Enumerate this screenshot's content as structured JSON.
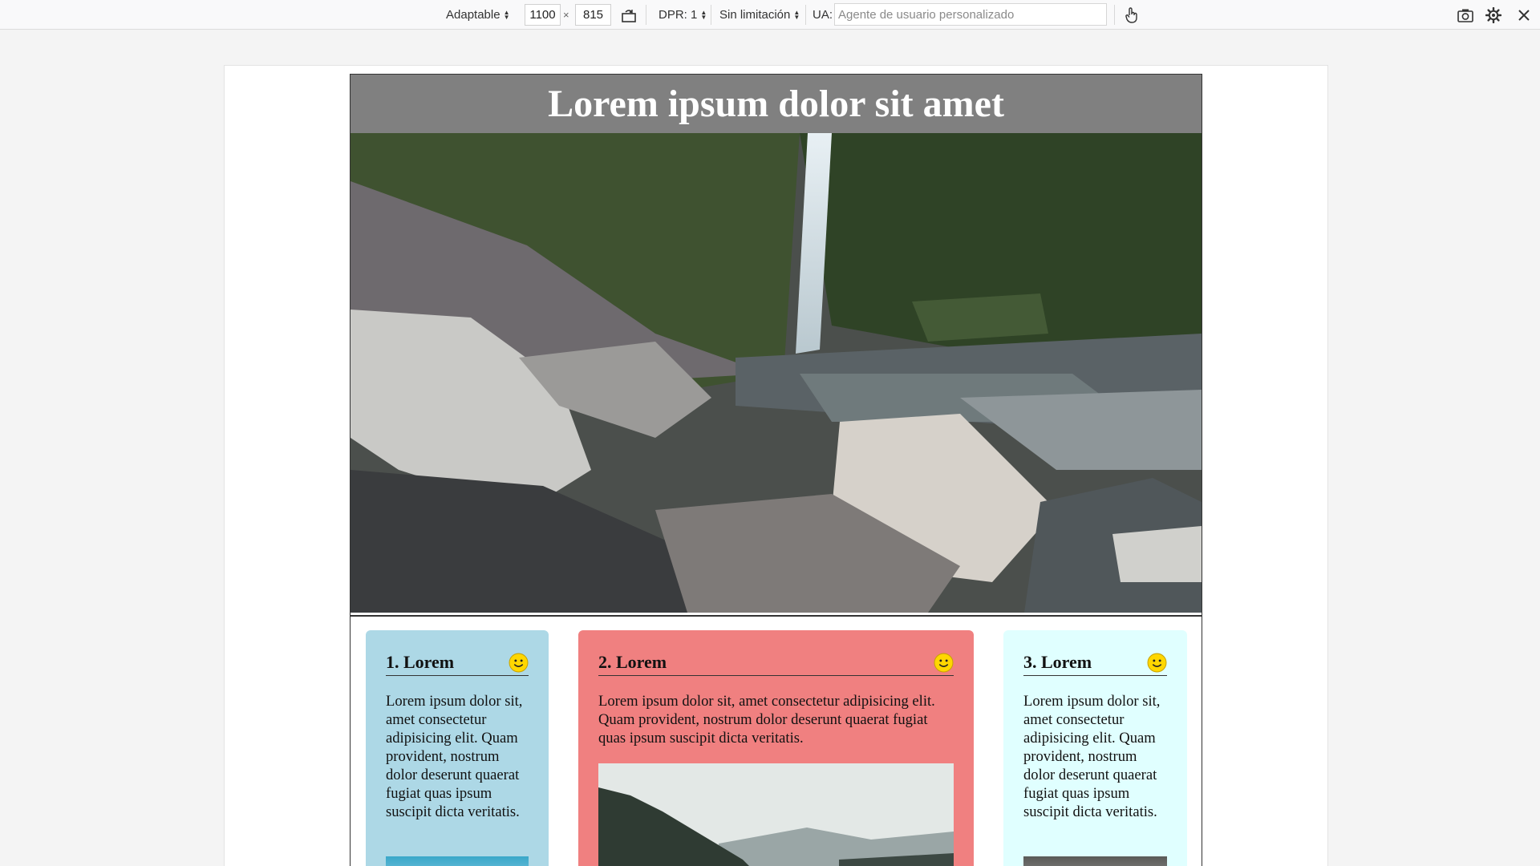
{
  "toolbar": {
    "device_label": "Adaptable",
    "width_value": "1100",
    "times_symbol": "×",
    "height_value": "815",
    "dpr_label": "DPR: 1",
    "throttle_label": "Sin limitación",
    "ua_label": "UA:",
    "ua_placeholder": "Agente de usuario personalizado",
    "icons": [
      "rotate-icon",
      "touch-icon",
      "screenshot-icon",
      "settings-icon",
      "close-icon"
    ]
  },
  "page": {
    "title": "Lorem ipsum dolor sit amet",
    "cards": [
      {
        "title": "1. Lorem",
        "text": "Lorem ipsum dolor sit, amet consectetur adipisicing elit. Quam provident, nostrum dolor deserunt quaerat fugiat quas ipsum suscipit dicta veritatis.",
        "color": "#add8e6"
      },
      {
        "title": "2. Lorem",
        "text": "Lorem ipsum dolor sit, amet consectetur adipisicing elit. Quam provident, nostrum dolor deserunt quaerat fugiat quas ipsum suscipit dicta veritatis.",
        "color": "#f08080"
      },
      {
        "title": "3. Lorem",
        "text": "Lorem ipsum dolor sit, amet consectetur adipisicing elit. Quam provident, nostrum dolor deserunt quaerat fugiat quas ipsum suscipit dicta veritatis.",
        "color": "#e0ffff"
      }
    ]
  },
  "colors": {
    "header_bg": "#808080",
    "header_text": "#ffffff",
    "smiley": "#ffd700"
  }
}
